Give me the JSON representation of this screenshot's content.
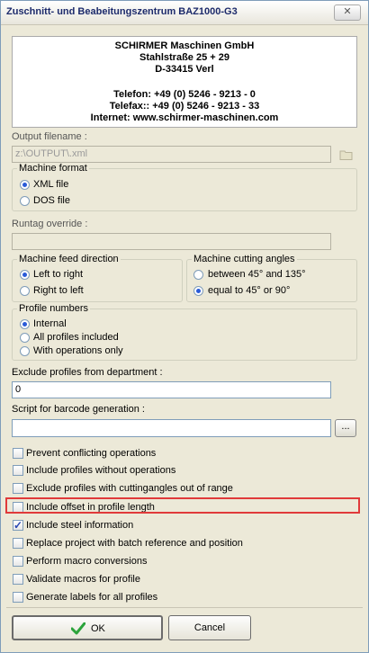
{
  "window": {
    "title": "Zuschnitt- und Beabeitungszentrum BAZ1000-G3",
    "close_label": "✕"
  },
  "company": {
    "name": "SCHIRMER Maschinen GmbH",
    "street": "Stahlstraße 25 + 29",
    "city": "D-33415 Verl",
    "phone": "Telefon:  +49 (0) 5246 - 9213 - 0",
    "fax": "Telefax:: +49 (0) 5246 - 9213 - 33",
    "internet": "Internet: www.schirmer-maschinen.com"
  },
  "output": {
    "label": "Output filename :",
    "value": "z:\\OUTPUT\\.xml"
  },
  "machine_format": {
    "legend": "Machine format",
    "options": [
      "XML file",
      "DOS file"
    ],
    "selected": "XML file"
  },
  "runtag": {
    "label": "Runtag override :",
    "value": ""
  },
  "feed_direction": {
    "legend": "Machine feed direction",
    "options": [
      "Left to right",
      "Right to left"
    ],
    "selected": "Left to right"
  },
  "cutting_angles": {
    "legend": "Machine cutting angles",
    "options": [
      "between 45° and 135°",
      "equal to 45° or 90°"
    ],
    "selected": "equal to 45° or 90°"
  },
  "profile_numbers": {
    "legend": "Profile numbers",
    "options": [
      "Internal",
      "All profiles included",
      "With operations only"
    ],
    "selected": "Internal"
  },
  "exclude_dept": {
    "label": "Exclude profiles from department :",
    "value": "0"
  },
  "barcode": {
    "label": "Script for barcode generation :",
    "value": "",
    "browse_label": "..."
  },
  "checkboxes": [
    {
      "label": "Prevent conflicting operations",
      "checked": false
    },
    {
      "label": "Include profiles without operations",
      "checked": false
    },
    {
      "label": "Exclude profiles with cuttingangles out of range",
      "checked": false
    },
    {
      "label": "Include offset in profile length",
      "checked": false
    },
    {
      "label": "Include steel information",
      "checked": true
    },
    {
      "label": "Replace project with batch reference and position",
      "checked": false
    },
    {
      "label": "Perform macro conversions",
      "checked": false
    },
    {
      "label": "Validate macros for profile",
      "checked": false
    },
    {
      "label": "Generate labels for all profiles",
      "checked": false
    }
  ],
  "buttons": {
    "ok": "OK",
    "cancel": "Cancel"
  },
  "colors": {
    "highlight": "#e03a3a",
    "check_mark": "#2ba33b"
  }
}
